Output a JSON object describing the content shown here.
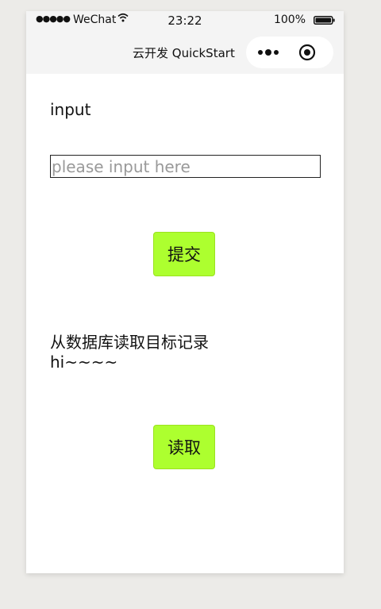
{
  "status_bar": {
    "signal": "●●●●●",
    "carrier": "WeChat",
    "time": "23:22",
    "battery_percent": "100%"
  },
  "nav": {
    "title": "云开发 QuickStart"
  },
  "form": {
    "input_label": "input",
    "input_placeholder": "please input here",
    "input_value": "",
    "submit_label": "提交"
  },
  "read_section": {
    "label": "从数据库读取目标记录",
    "value": "hi~~~~",
    "read_label": "读取"
  },
  "colors": {
    "button_bg": "#adff2f",
    "page_bg": "#ecebe8",
    "bar_bg": "#f4f4f4"
  },
  "icons": {
    "wifi": "wifi-icon",
    "battery": "battery-icon",
    "more": "more-dots-icon",
    "close": "miniprogram-close-icon"
  }
}
